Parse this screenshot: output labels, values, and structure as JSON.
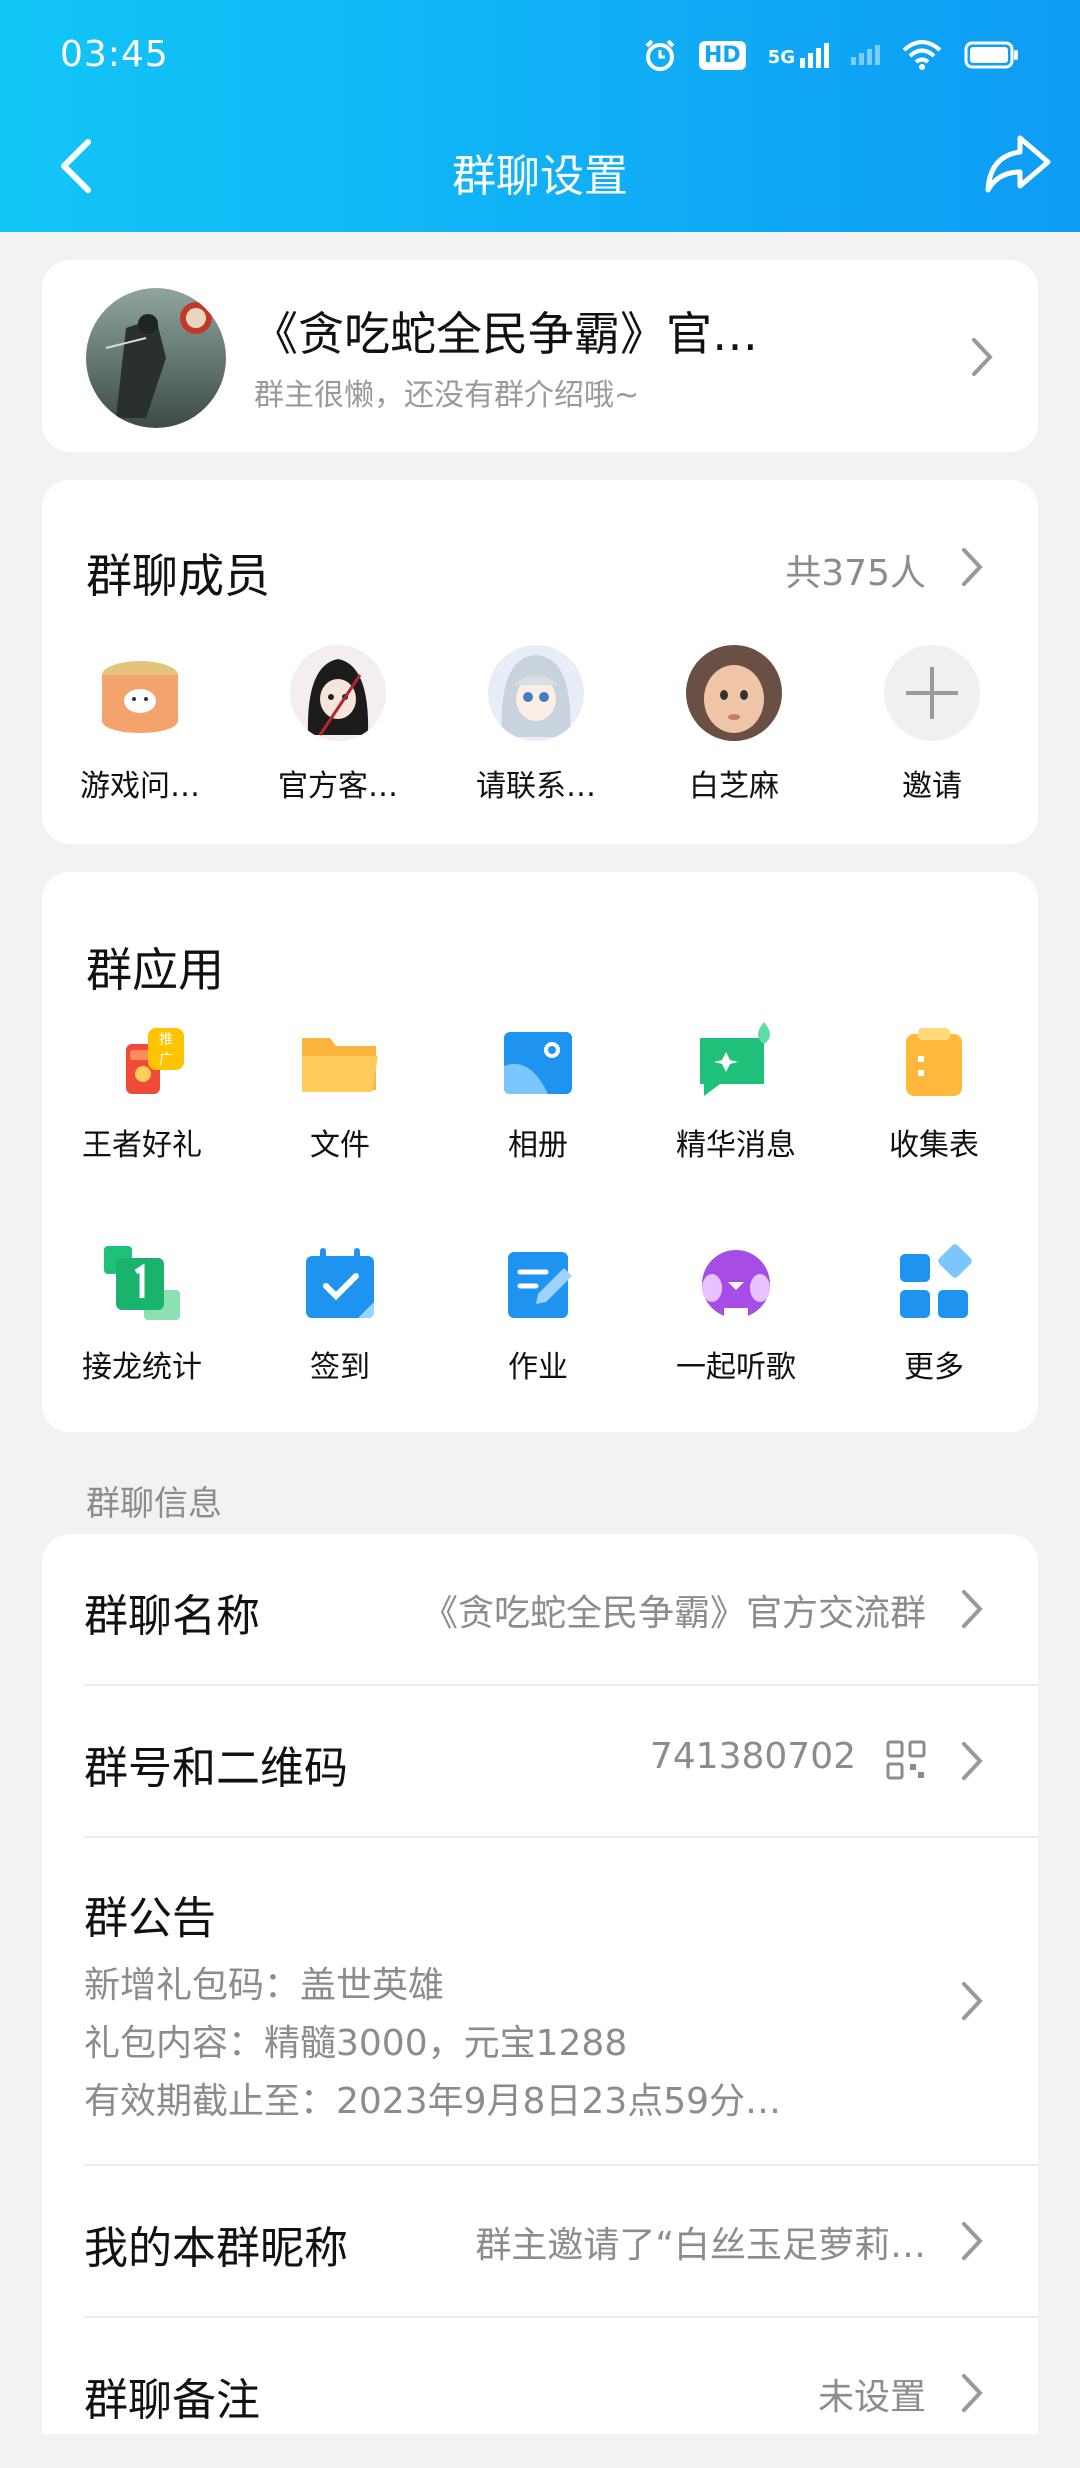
{
  "status_bar": {
    "time": "03:45",
    "hd_label": "HD",
    "network_label": "5G"
  },
  "nav": {
    "title": "群聊设置"
  },
  "group": {
    "name": "《贪吃蛇全民争霸》官…",
    "intro": "群主很懒，还没有群介绍哦~"
  },
  "members": {
    "title": "群聊成员",
    "count": "共375人",
    "list": [
      {
        "name": "游戏问…"
      },
      {
        "name": "官方客…"
      },
      {
        "name": "请联系…"
      },
      {
        "name": "白芝麻"
      },
      {
        "name": "邀请"
      }
    ]
  },
  "apps": {
    "title": "群应用",
    "badge": "推广",
    "items": [
      {
        "label": "王者好礼",
        "icon": "gift-icon"
      },
      {
        "label": "文件",
        "icon": "folder-icon"
      },
      {
        "label": "相册",
        "icon": "album-icon"
      },
      {
        "label": "精华消息",
        "icon": "essence-message-icon"
      },
      {
        "label": "收集表",
        "icon": "clipboard-icon"
      },
      {
        "label": "接龙统计",
        "icon": "relay-stat-icon"
      },
      {
        "label": "签到",
        "icon": "checkin-calendar-icon"
      },
      {
        "label": "作业",
        "icon": "homework-icon"
      },
      {
        "label": "一起听歌",
        "icon": "listen-music-icon"
      },
      {
        "label": "更多",
        "icon": "more-grid-icon"
      }
    ]
  },
  "info": {
    "section_label": "群聊信息",
    "name_row": {
      "title": "群聊名称",
      "value": "《贪吃蛇全民争霸》官方交流群"
    },
    "id_row": {
      "title": "群号和二维码",
      "value": "741380702"
    },
    "notice": {
      "title": "群公告",
      "lines": [
        "新增礼包码：盖世英雄",
        "礼包内容：精髓3000，元宝1288",
        "有效期截止至：2023年9月8日23点59分…"
      ]
    },
    "nickname_row": {
      "title": "我的本群昵称",
      "value": "群主邀请了“白丝玉足萝莉…"
    },
    "remark_row": {
      "title": "群聊备注",
      "value": "未设置"
    }
  },
  "colors": {
    "header_gradient_start": "#12c6f7",
    "header_gradient_end": "#0e9cf5",
    "background": "#f2f2f2",
    "secondary_text": "#8c8c8c"
  }
}
